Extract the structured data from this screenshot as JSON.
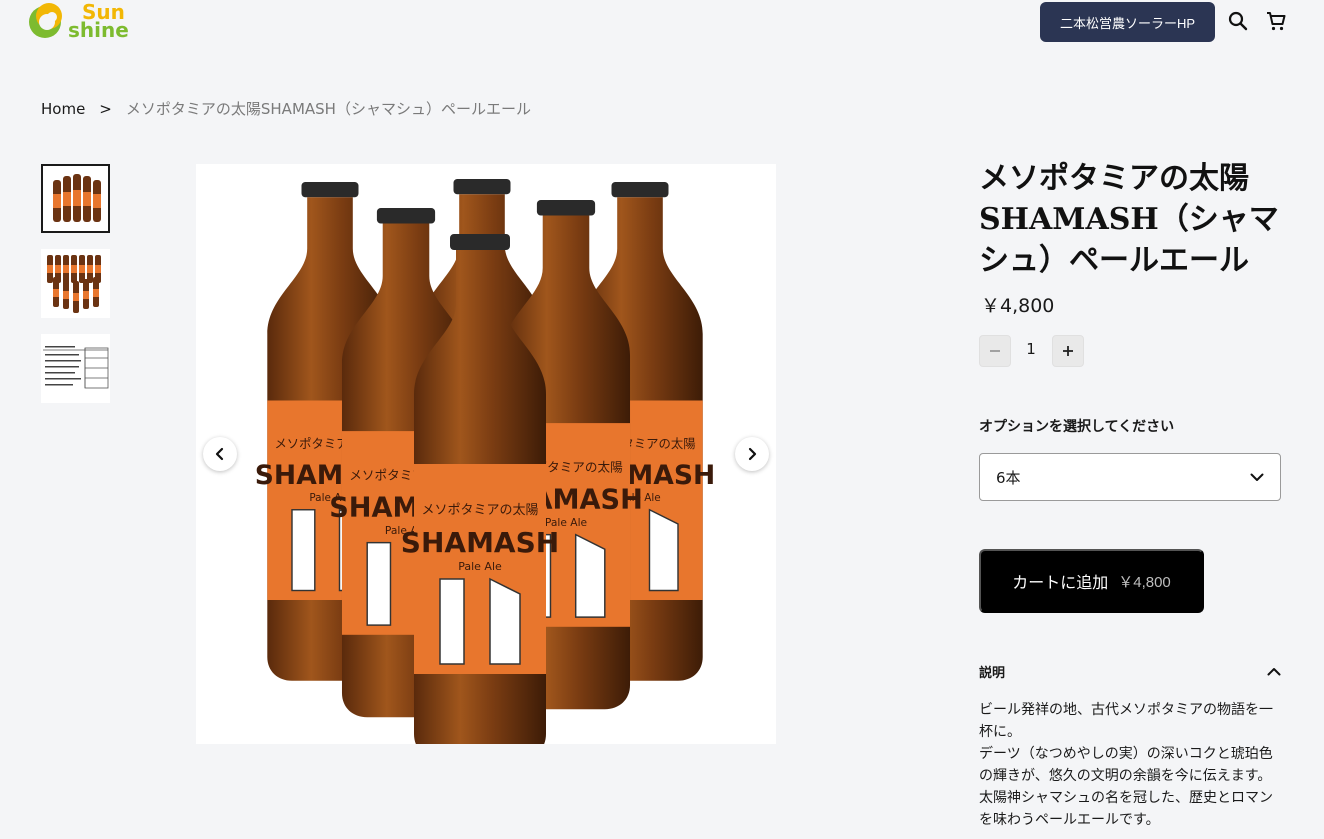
{
  "header": {
    "logo_line1": "Sun",
    "logo_line2": "shine",
    "hp_button": "二本松営農ソーラーHP",
    "search_icon": "search-icon",
    "cart_icon": "cart-icon"
  },
  "breadcrumb": {
    "home": "Home",
    "separator": ">",
    "current": "メソポタミアの太陽SHAMASH（シャマシュ）ペールエール"
  },
  "gallery": {
    "thumbnails": [
      "6-bottle photo",
      "12-bottle photo",
      "label table"
    ],
    "active_index": 0
  },
  "product": {
    "title": "メソポタミアの太陽SHAMASH（シャマシュ）ペールエール",
    "price": "￥4,800",
    "quantity": "1",
    "option_label": "オプションを選択してください",
    "option_selected": "6本",
    "add_to_cart_label": "カートに追加",
    "add_to_cart_price": "￥4,800",
    "description_heading": "説明",
    "description_lines": [
      "ビール発祥の地、古代メソポタミアの物語を一杯に。",
      "デーツ（なつめやしの実）の深いコクと琥珀色の輝きが、悠久の文明の余韻を今に伝えます。",
      "太陽神シャマシュの名を冠した、歴史とロマンを味わうペールエールです。"
    ]
  },
  "colors": {
    "hp_button_bg": "#2b3553",
    "cart_button_bg": "#000000",
    "logo_yellow": "#f2b705",
    "logo_green": "#7dbb2f",
    "label_orange": "#e8762d"
  }
}
